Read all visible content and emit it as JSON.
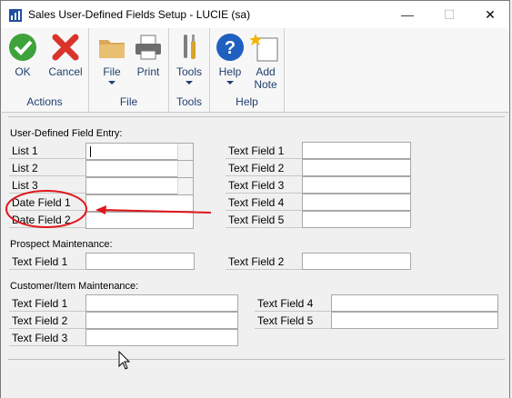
{
  "window": {
    "title": "Sales User-Defined Fields Setup  -  LUCIE (sa)",
    "minimize": "—",
    "maximize": "☐",
    "close": "✕"
  },
  "ribbon": {
    "groups": [
      {
        "label": "Actions",
        "buttons": [
          "OK",
          "Cancel"
        ]
      },
      {
        "label": "File",
        "buttons": [
          "File",
          "Print"
        ]
      },
      {
        "label": "Tools",
        "buttons": [
          "Tools"
        ]
      },
      {
        "label": "Help",
        "buttons": [
          "Help",
          "Add\nNote"
        ]
      }
    ],
    "add_note_line1": "Add",
    "add_note_line2": "Note"
  },
  "udf_entry": {
    "heading": "User-Defined Field Entry:",
    "left": [
      "List 1",
      "List 2",
      "List 3",
      "Date Field 1",
      "Date Field 2"
    ],
    "right": [
      "Text Field 1",
      "Text Field 2",
      "Text Field 3",
      "Text Field 4",
      "Text Field 5"
    ]
  },
  "prospect": {
    "heading": "Prospect Maintenance:",
    "left": "Text Field 1",
    "right": "Text Field 2"
  },
  "customer_item": {
    "heading": "Customer/Item Maintenance:",
    "left": [
      "Text Field 1",
      "Text Field 2",
      "Text Field 3"
    ],
    "right": [
      "Text Field 4",
      "Text Field 5"
    ]
  },
  "annotation_color": "#e0161c",
  "accent": {
    "ok_green": "#3da33a",
    "cancel_red": "#d9342b",
    "help_blue": "#1f5fbf"
  }
}
